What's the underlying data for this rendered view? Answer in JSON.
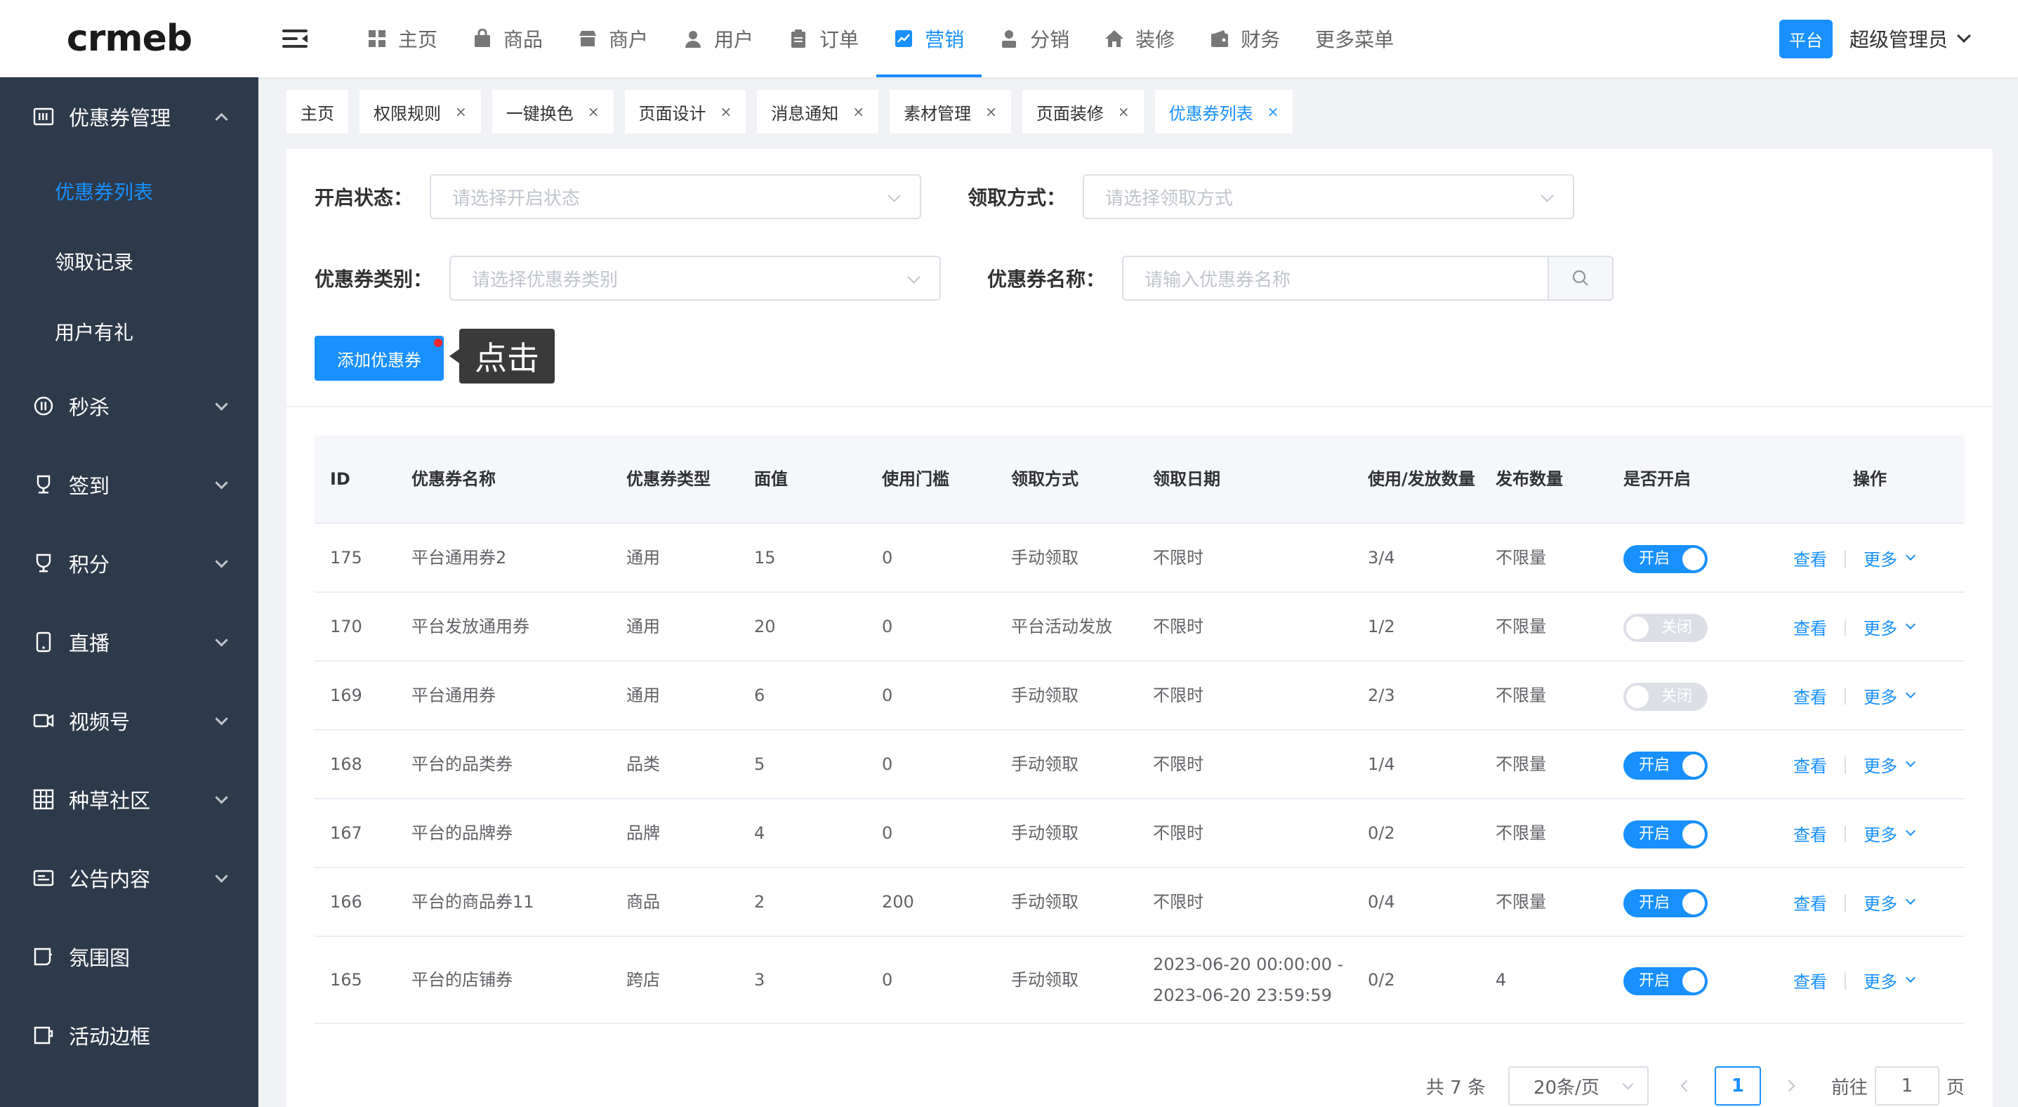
{
  "logo": "crmeb",
  "topnav": [
    {
      "label": "主页",
      "icon": "grid-icon"
    },
    {
      "label": "商品",
      "icon": "bag-icon"
    },
    {
      "label": "商户",
      "icon": "store-icon"
    },
    {
      "label": "用户",
      "icon": "user-icon"
    },
    {
      "label": "订单",
      "icon": "clipboard-icon"
    },
    {
      "label": "营销",
      "icon": "chart-icon"
    },
    {
      "label": "分销",
      "icon": "distribution-icon"
    },
    {
      "label": "装修",
      "icon": "home-icon"
    },
    {
      "label": "财务",
      "icon": "wallet-icon"
    },
    {
      "label": "更多菜单"
    }
  ],
  "header": {
    "role": "平台",
    "admin": "超级管理员"
  },
  "sidebar": {
    "coupon_group": "优惠券管理",
    "sub_items": [
      "优惠券列表",
      "领取记录",
      "用户有礼"
    ],
    "groups": [
      "秒杀",
      "签到",
      "积分",
      "直播",
      "视频号",
      "种草社区",
      "公告内容",
      "氛围图",
      "活动边框"
    ]
  },
  "tags": [
    {
      "label": "主页"
    },
    {
      "label": "权限规则",
      "close": "×"
    },
    {
      "label": "一键换色",
      "close": "×"
    },
    {
      "label": "页面设计",
      "close": "×"
    },
    {
      "label": "消息通知",
      "close": "×"
    },
    {
      "label": "素材管理",
      "close": "×"
    },
    {
      "label": "页面装修",
      "close": "×"
    },
    {
      "label": "优惠券列表",
      "close": "×"
    }
  ],
  "filters": {
    "status_label": "开启状态：",
    "status_placeholder": "请选择开启状态",
    "way_label": "领取方式：",
    "way_placeholder": "请选择领取方式",
    "category_label": "优惠券类别：",
    "category_placeholder": "请选择优惠券类别",
    "name_label": "优惠券名称：",
    "name_placeholder": "请输入优惠券名称"
  },
  "add_button": "添加优惠券",
  "tooltip": "点击",
  "table": {
    "headers": [
      "ID",
      "优惠券名称",
      "优惠券类型",
      "面值",
      "使用门槛",
      "领取方式",
      "领取日期",
      "使用/发放数量",
      "发布数量",
      "是否开启",
      "操作"
    ],
    "rows": [
      {
        "id": "175",
        "name": "平台通用券2",
        "type": "通用",
        "value": "15",
        "threshold": "0",
        "way": "手动领取",
        "date": "不限时",
        "used": "3/4",
        "pub": "不限量",
        "status": "开启",
        "on": true
      },
      {
        "id": "170",
        "name": "平台发放通用券",
        "type": "通用",
        "value": "20",
        "threshold": "0",
        "way": "平台活动发放",
        "date": "不限时",
        "used": "1/2",
        "pub": "不限量",
        "status": "关闭",
        "on": false
      },
      {
        "id": "169",
        "name": "平台通用券",
        "type": "通用",
        "value": "6",
        "threshold": "0",
        "way": "手动领取",
        "date": "不限时",
        "used": "2/3",
        "pub": "不限量",
        "status": "关闭",
        "on": false
      },
      {
        "id": "168",
        "name": "平台的品类券",
        "type": "品类",
        "value": "5",
        "threshold": "0",
        "way": "手动领取",
        "date": "不限时",
        "used": "1/4",
        "pub": "不限量",
        "status": "开启",
        "on": true
      },
      {
        "id": "167",
        "name": "平台的品牌券",
        "type": "品牌",
        "value": "4",
        "threshold": "0",
        "way": "手动领取",
        "date": "不限时",
        "used": "0/2",
        "pub": "不限量",
        "status": "开启",
        "on": true
      },
      {
        "id": "166",
        "name": "平台的商品券11",
        "type": "商品",
        "value": "2",
        "threshold": "200",
        "way": "手动领取",
        "date": "不限时",
        "used": "0/4",
        "pub": "不限量",
        "status": "开启",
        "on": true
      },
      {
        "id": "165",
        "name": "平台的店铺券",
        "type": "跨店",
        "value": "3",
        "threshold": "0",
        "way": "手动领取",
        "date": "2023-06-20 00:00:00 - 2023-06-20 23:59:59",
        "used": "0/2",
        "pub": "4",
        "status": "开启",
        "on": true
      }
    ],
    "op_view": "查看",
    "op_sep": "|",
    "op_more": "更多"
  },
  "pager": {
    "total": "共 7 条",
    "size": "20条/页",
    "page": "1",
    "goto": "前往",
    "goto_value": "1",
    "unit": "页"
  },
  "colors": {
    "primary": "#1890ff",
    "sidebar": "#2d3a4b"
  }
}
